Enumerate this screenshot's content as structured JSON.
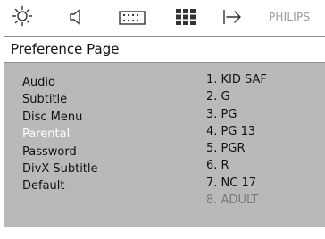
{
  "toolbar": {
    "icons": [
      "settings-icon",
      "audio-icon",
      "display-icon",
      "grid-icon",
      "exit-icon"
    ],
    "brand": "PHILIPS"
  },
  "page": {
    "title": "Preference Page"
  },
  "menu": {
    "items": [
      {
        "label": "Audio"
      },
      {
        "label": "Subtitle"
      },
      {
        "label": "Disc Menu"
      },
      {
        "label": "Parental"
      },
      {
        "label": "Password"
      },
      {
        "label": "DivX Subtitle"
      },
      {
        "label": "Default"
      }
    ],
    "selected": "Parental"
  },
  "options": {
    "items": [
      {
        "label": "1. KID SAF"
      },
      {
        "label": "2. G"
      },
      {
        "label": "3. PG"
      },
      {
        "label": "4. PG 13"
      },
      {
        "label": "5. PGR"
      },
      {
        "label": "6. R"
      },
      {
        "label": "7. NC 17"
      },
      {
        "label": "8. ADULT"
      }
    ]
  },
  "colors": {
    "panel": "#b9b9b9",
    "selected_text": "#ffffff",
    "dim_text": "#7a7a7a",
    "brand": "#9a9a9a"
  }
}
